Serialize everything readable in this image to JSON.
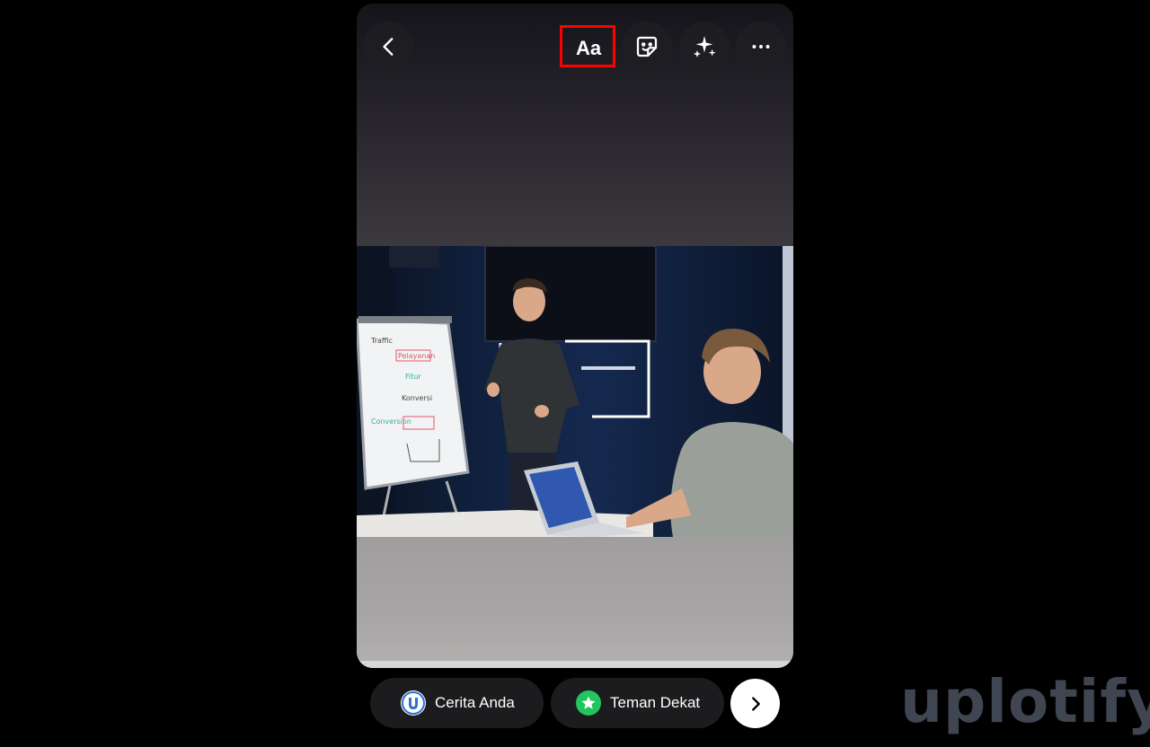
{
  "toolbar": {
    "text_tool_label": "Aa",
    "back_icon": "chevron-left-icon",
    "sticker_icon": "sticker-icon",
    "effects_icon": "sparkles-icon",
    "more_icon": "more-horizontal-icon",
    "highlight_color": "#ff0000"
  },
  "photo": {
    "whiteboard_lines": [
      "Traffic",
      "Pelayanan",
      "Fitur",
      "Konversi",
      "Conversion"
    ]
  },
  "share_bar": {
    "your_story_label": "Cerita Anda",
    "close_friends_label": "Teman Dekat",
    "your_story_icon": "avatar-icon",
    "close_friends_icon": "star-icon",
    "close_friends_color": "#22c55e",
    "next_icon": "chevron-right-icon"
  },
  "watermark": {
    "text": "uplotify"
  }
}
